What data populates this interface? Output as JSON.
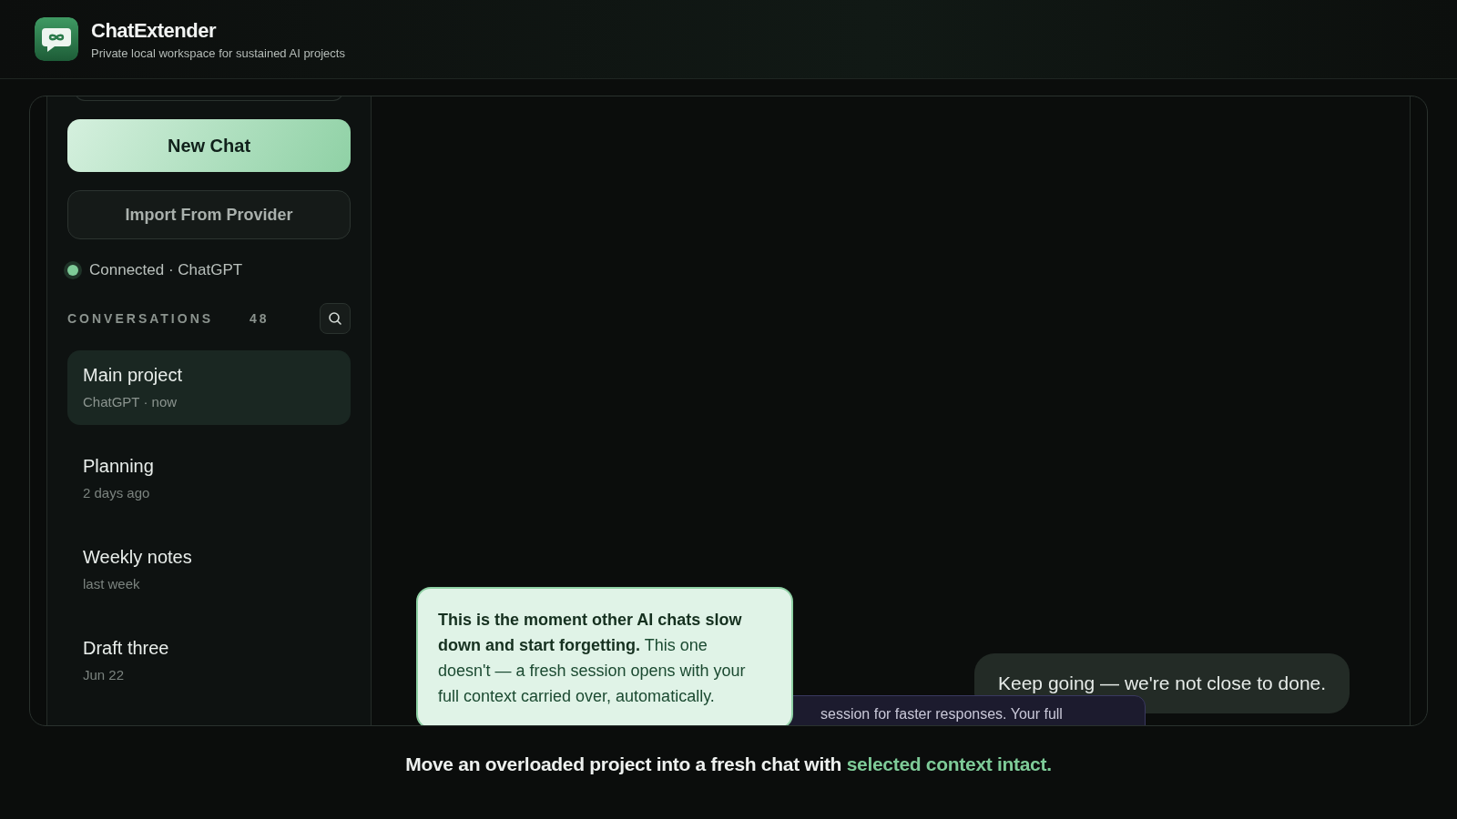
{
  "app": {
    "title": "ChatExtender",
    "subtitle": "Private local workspace for sustained AI projects"
  },
  "sidebar": {
    "new_chat_button": "New Chat",
    "import_button": "Import From Provider",
    "connection": {
      "label": "Connected · ChatGPT",
      "connected": true
    },
    "conversations_heading": "CONVERSATIONS",
    "conversations_count": "48",
    "conversations": [
      {
        "title": "Main project",
        "meta": "ChatGPT · now",
        "selected": true
      },
      {
        "title": "Planning",
        "meta": "2 days ago",
        "selected": false
      },
      {
        "title": "Weekly notes",
        "meta": "last week",
        "selected": false
      },
      {
        "title": "Draft three",
        "meta": "Jun 22",
        "selected": false
      }
    ]
  },
  "chat": {
    "tooltip": "**This is the moment other AI chats slow down and start forgetting.** This one doesn't — a fresh session opens with your full context carried over, automatically.",
    "banner": "session for faster responses. Your full",
    "user_message": "Keep going — we're not close to done."
  },
  "caption": {
    "text": "Move an overloaded project into a fresh chat with",
    "highlight": "selected context intact."
  }
}
